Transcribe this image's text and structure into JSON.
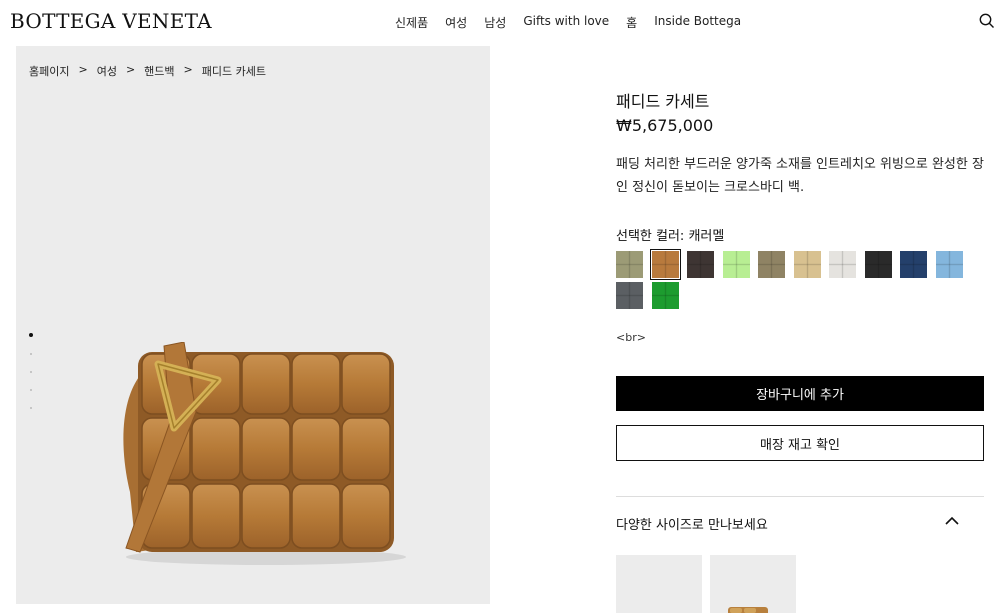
{
  "header": {
    "logo": "BOTTEGA VENETA",
    "nav": [
      "신제품",
      "여성",
      "남성",
      "Gifts with love",
      "홈",
      "Inside Bottega"
    ],
    "search_icon": "search-icon"
  },
  "breadcrumb": [
    "홈페이지",
    "여성",
    "핸드백",
    "패디드 카세트"
  ],
  "breadcrumb_separator": ">",
  "gallery": {
    "slide_count": 5,
    "active_slide": 1
  },
  "product": {
    "title": "패디드 카세트",
    "price": "₩5,675,000",
    "description": "패딩 처리한 부드러운 양가죽 소재를 인트레치오 위빙으로 완성한 장인 정신이 돋보이는 크로스바디 백.",
    "color_label": "선택한 컬러: 캐러멜",
    "swatches": [
      {
        "color": "#9c9b76",
        "selected": false
      },
      {
        "color": "#b87a3d",
        "selected": true
      },
      {
        "color": "#3e3533",
        "selected": false
      },
      {
        "color": "#b8ee93",
        "selected": false
      },
      {
        "color": "#8f8364",
        "selected": false
      },
      {
        "color": "#d8c190",
        "selected": false
      },
      {
        "color": "#e5e3df",
        "selected": false
      },
      {
        "color": "#2a2a2a",
        "selected": false
      },
      {
        "color": "#24406b",
        "selected": false
      },
      {
        "color": "#84b6dd",
        "selected": false
      },
      {
        "color": "#5b5f63",
        "selected": false
      },
      {
        "color": "#1d9c2f",
        "selected": false
      }
    ],
    "br_text": "<br>",
    "add_to_cart": "장바구니에 추가",
    "check_store": "매장 재고 확인",
    "sizes_label": "다양한 사이즈로 만나보세요",
    "size_thumbs": 2
  },
  "colors": {
    "bag_leather": "#b9823e",
    "hardware": "#caa548",
    "gallery_bg": "#ececec"
  }
}
